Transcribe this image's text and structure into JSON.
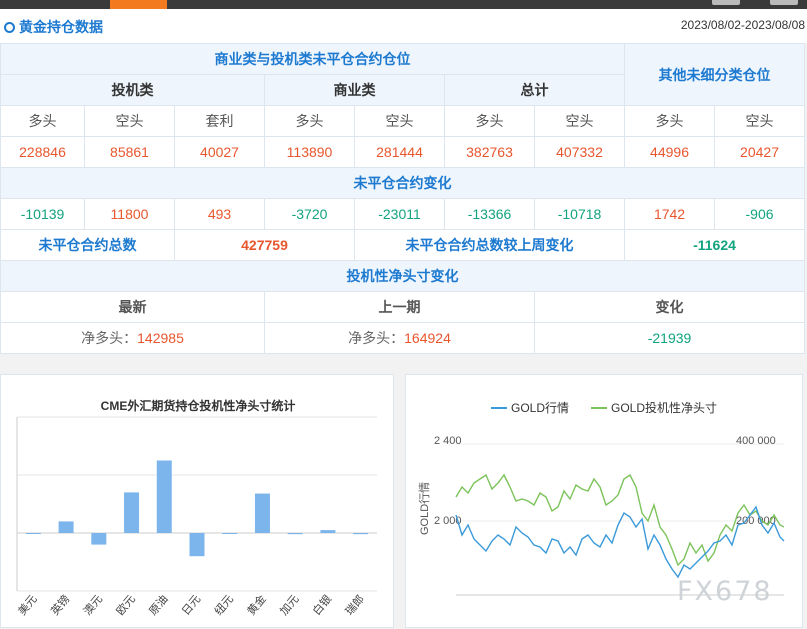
{
  "header": {
    "title": "黄金持仓数据",
    "date_range": "2023/08/02-2023/08/08"
  },
  "table": {
    "group_header": "商业类与投机类未平仓合约仓位",
    "other_header": "其他未细分类仓位",
    "spec_label": "投机类",
    "comm_label": "商业类",
    "total_label": "总计",
    "long": "多头",
    "short": "空头",
    "spread": "套利",
    "positions": [
      "228846",
      "85861",
      "40027",
      "113890",
      "281444",
      "382763",
      "407332",
      "44996",
      "20427"
    ],
    "change_title": "未平仓合约变化",
    "changes": [
      "-10139",
      "11800",
      "493",
      "-3720",
      "-23011",
      "-13366",
      "-10718",
      "1742",
      "-906"
    ],
    "oi_total_label": "未平仓合约总数",
    "oi_total_value": "427759",
    "oi_change_label": "未平仓合约总数较上周变化",
    "oi_change_value": "-11624",
    "net_title": "投机性净头寸变化",
    "latest_label": "最新",
    "prev_label": "上一期",
    "change_label": "变化",
    "net_prefix": "净多头：",
    "latest_value": "142985",
    "prev_value": "164924",
    "net_change": "-21939"
  },
  "chart_data": [
    {
      "type": "bar",
      "title": "CME外汇期货持仓投机性净头寸统计",
      "categories": [
        "美元",
        "英镑",
        "澳元",
        "欧元",
        "原油",
        "日元",
        "纽元",
        "黄金",
        "加元",
        "白银",
        "瑞郎"
      ],
      "values": [
        0,
        20000,
        -20000,
        70000,
        125000,
        -40000,
        0,
        68000,
        -2000,
        5000,
        -2000
      ],
      "ylim": [
        -100000,
        200000
      ],
      "color": "#7cb5ec"
    },
    {
      "type": "line",
      "legend": [
        "GOLD行情",
        "GOLD投机性净头寸"
      ],
      "ylabel_left": "GOLD行情",
      "left_ticks": [
        "2 400",
        "2 000"
      ],
      "right_ticks": [
        "400 000",
        "200 000"
      ],
      "series_colors": [
        "#3a9ad9",
        "#7cc35b"
      ]
    }
  ],
  "watermark": "FX678"
}
